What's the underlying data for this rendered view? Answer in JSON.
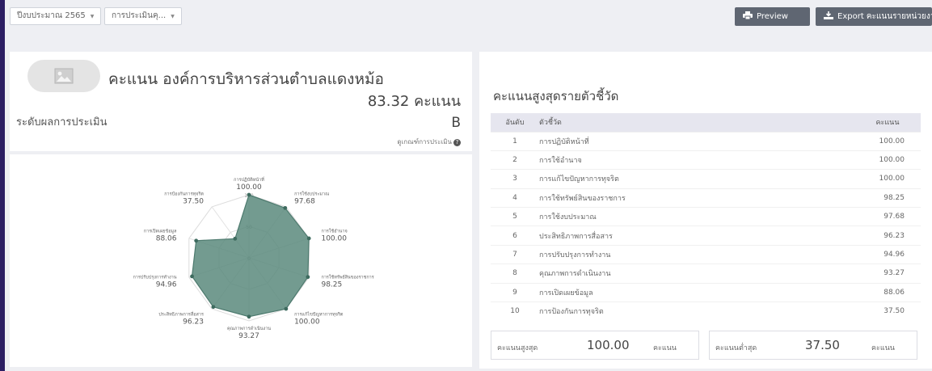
{
  "filters": {
    "fiscal_year": "ปีงบประมาณ 2565",
    "assessment": "การประเมินคุ..."
  },
  "toolbar": {
    "preview_label": "Preview",
    "export_label": "Export คะแนนรายหน่วยงาน",
    "button_color": "#5f6672"
  },
  "org": {
    "title": "คะแนน องค์การบริหารส่วนตำบลแดงหม้อ",
    "score_text": "83.32 คะแนน",
    "level_label": "ระดับผลการประเมิน",
    "level_value": "B",
    "criteria_link": "ดูเกณฑ์การประเมิน"
  },
  "radar": {
    "fill_color": "#5a8a7c",
    "scale_ticks": [
      "0",
      "50",
      "100"
    ],
    "axes": [
      {
        "label": "การปฏิบัติหน้าที่",
        "value": 100.0,
        "value_text": "100.00"
      },
      {
        "label": "การใช้งบประมาณ",
        "value": 97.68,
        "value_text": "97.68"
      },
      {
        "label": "การใช้อำนาจ",
        "value": 100.0,
        "value_text": "100.00"
      },
      {
        "label": "การใช้ทรัพย์สินของราชการ",
        "value": 98.25,
        "value_text": "98.25"
      },
      {
        "label": "การแก้ไขปัญหาการทุจริต",
        "value": 100.0,
        "value_text": "100.00"
      },
      {
        "label": "คุณภาพการดำเนินงาน",
        "value": 93.27,
        "value_text": "93.27"
      },
      {
        "label": "ประสิทธิภาพการสื่อสาร",
        "value": 96.23,
        "value_text": "96.23"
      },
      {
        "label": "การปรับปรุงการทำงาน",
        "value": 94.96,
        "value_text": "94.96"
      },
      {
        "label": "การเปิดเผยข้อมูล",
        "value": 88.06,
        "value_text": "88.06"
      },
      {
        "label": "การป้องกันการทุจริต",
        "value": 37.5,
        "value_text": "37.50"
      }
    ]
  },
  "ranking": {
    "title": "คะแนนสูงสุดรายตัวชี้วัด",
    "headers": [
      "อันดับ",
      "ตัวชี้วัด",
      "คะแนน"
    ],
    "rows": [
      {
        "rank": "1",
        "name": "การปฏิบัติหน้าที่",
        "score": "100.00"
      },
      {
        "rank": "2",
        "name": "การใช้อำนาจ",
        "score": "100.00"
      },
      {
        "rank": "3",
        "name": "การแก้ไขปัญหาการทุจริต",
        "score": "100.00"
      },
      {
        "rank": "4",
        "name": "การใช้ทรัพย์สินของราชการ",
        "score": "98.25"
      },
      {
        "rank": "5",
        "name": "การใช้งบประมาณ",
        "score": "97.68"
      },
      {
        "rank": "6",
        "name": "ประสิทธิภาพการสื่อสาร",
        "score": "96.23"
      },
      {
        "rank": "7",
        "name": "การปรับปรุงการทำงาน",
        "score": "94.96"
      },
      {
        "rank": "8",
        "name": "คุณภาพการดำเนินงาน",
        "score": "93.27"
      },
      {
        "rank": "9",
        "name": "การเปิดเผยข้อมูล",
        "score": "88.06"
      },
      {
        "rank": "10",
        "name": "การป้องกันการทุจริต",
        "score": "37.50"
      }
    ]
  },
  "summary": {
    "max_label": "คะแนนสูงสุด",
    "max_value": "100.00",
    "min_label": "คะแนนต่ำสุด",
    "min_value": "37.50",
    "unit": "คะแนน"
  }
}
